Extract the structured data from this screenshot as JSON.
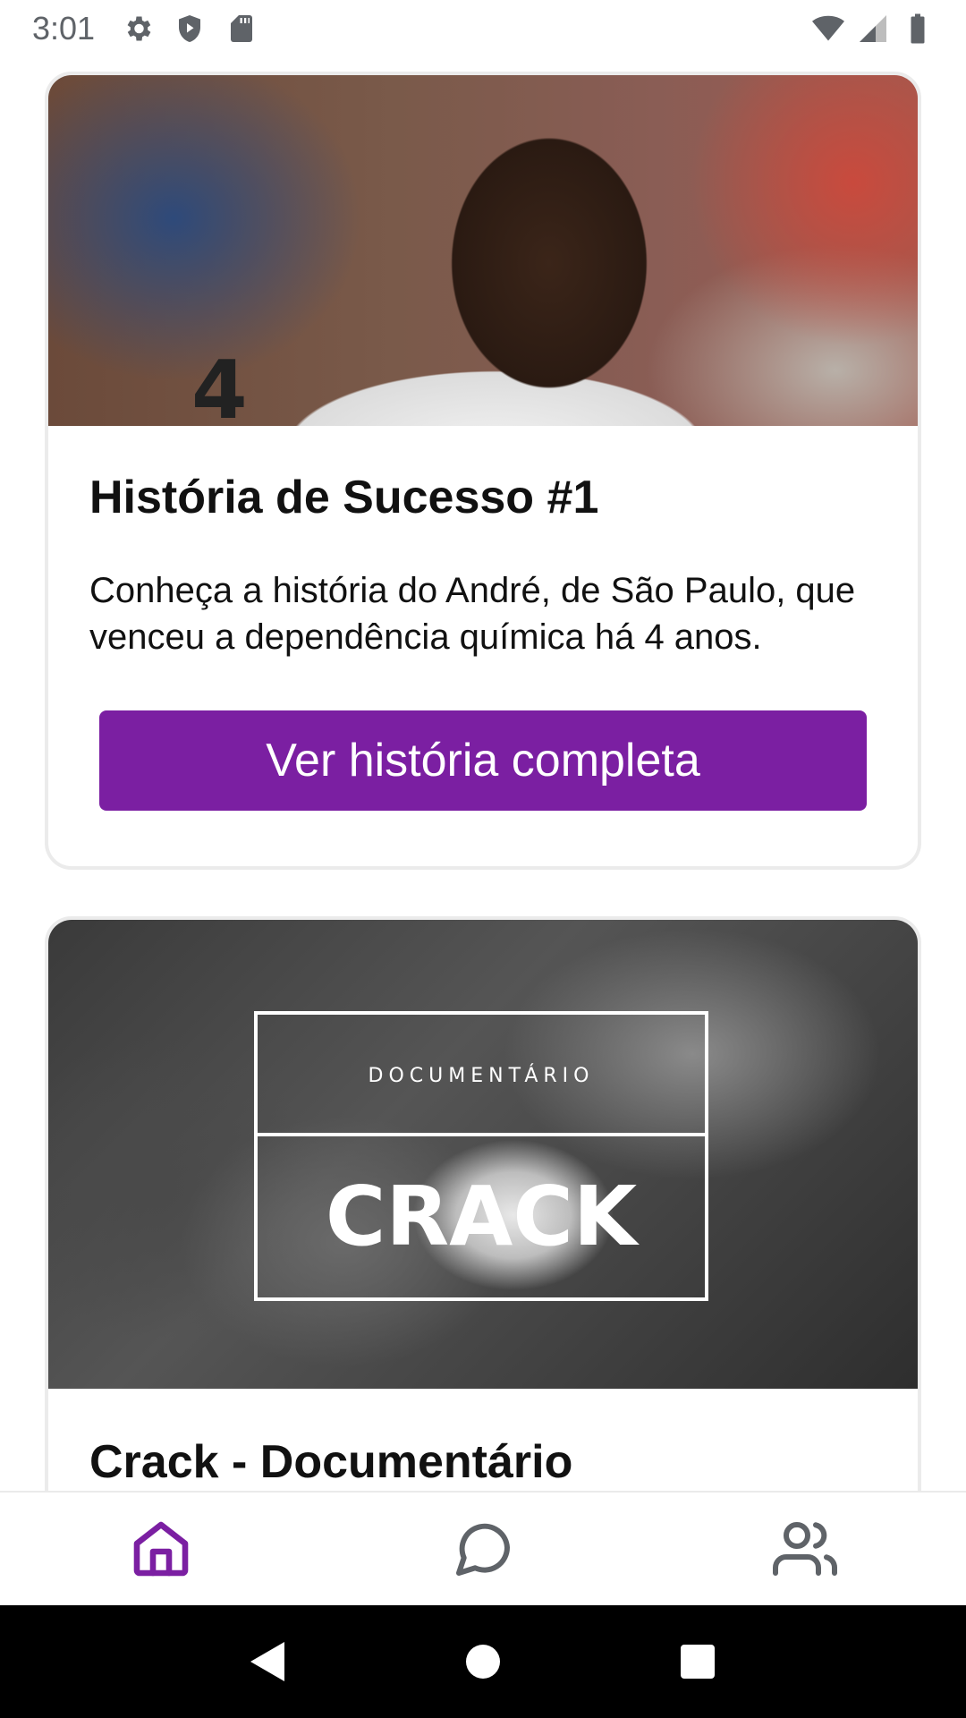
{
  "status_bar": {
    "time": "3:01",
    "left_icons": [
      "gear-icon",
      "shield-play-icon",
      "sd-card-icon"
    ],
    "right_icons": [
      "wifi-icon",
      "signal-icon",
      "battery-icon"
    ]
  },
  "feed": {
    "cards": [
      {
        "title": "História de Sucesso #1",
        "description": "Conheça a história do André, de São Paulo, que venceu a dependência química há 4 anos.",
        "button_label": "Ver história completa"
      },
      {
        "image_kicker": "DOCUMENTÁRIO",
        "image_title": "CRACK",
        "title": "Crack - Documentário"
      }
    ]
  },
  "bottom_nav": {
    "items": [
      {
        "icon": "home-icon",
        "active": true
      },
      {
        "icon": "chat-icon",
        "active": false
      },
      {
        "icon": "users-icon",
        "active": false
      }
    ],
    "active_color": "#7b1fa2",
    "inactive_color": "#5f6368"
  },
  "accent_color": "#7b1fa2"
}
